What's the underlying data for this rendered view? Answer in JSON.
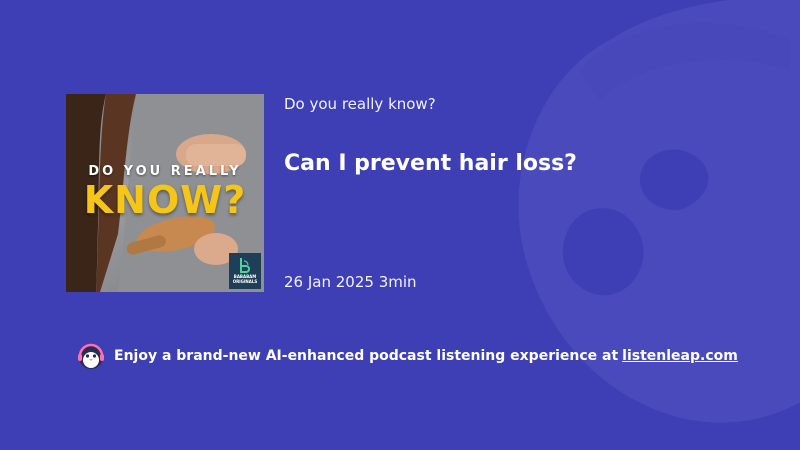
{
  "background_color": "#3f3fb5",
  "episode": {
    "series": "Do you really know?",
    "title": "Can I prevent hair loss?",
    "date": "26 Jan 2025",
    "duration": "3min"
  },
  "cover": {
    "line1": "DO YOU REALLY",
    "line2": "KNOW?",
    "brand": "BABABAM ORIGINALS",
    "accent_color": "#f5c518"
  },
  "footer": {
    "icon": "penguin-headphones-icon",
    "text": "Enjoy a brand-new AI-enhanced podcast listening experience at",
    "link_text": "listenleap.com"
  }
}
